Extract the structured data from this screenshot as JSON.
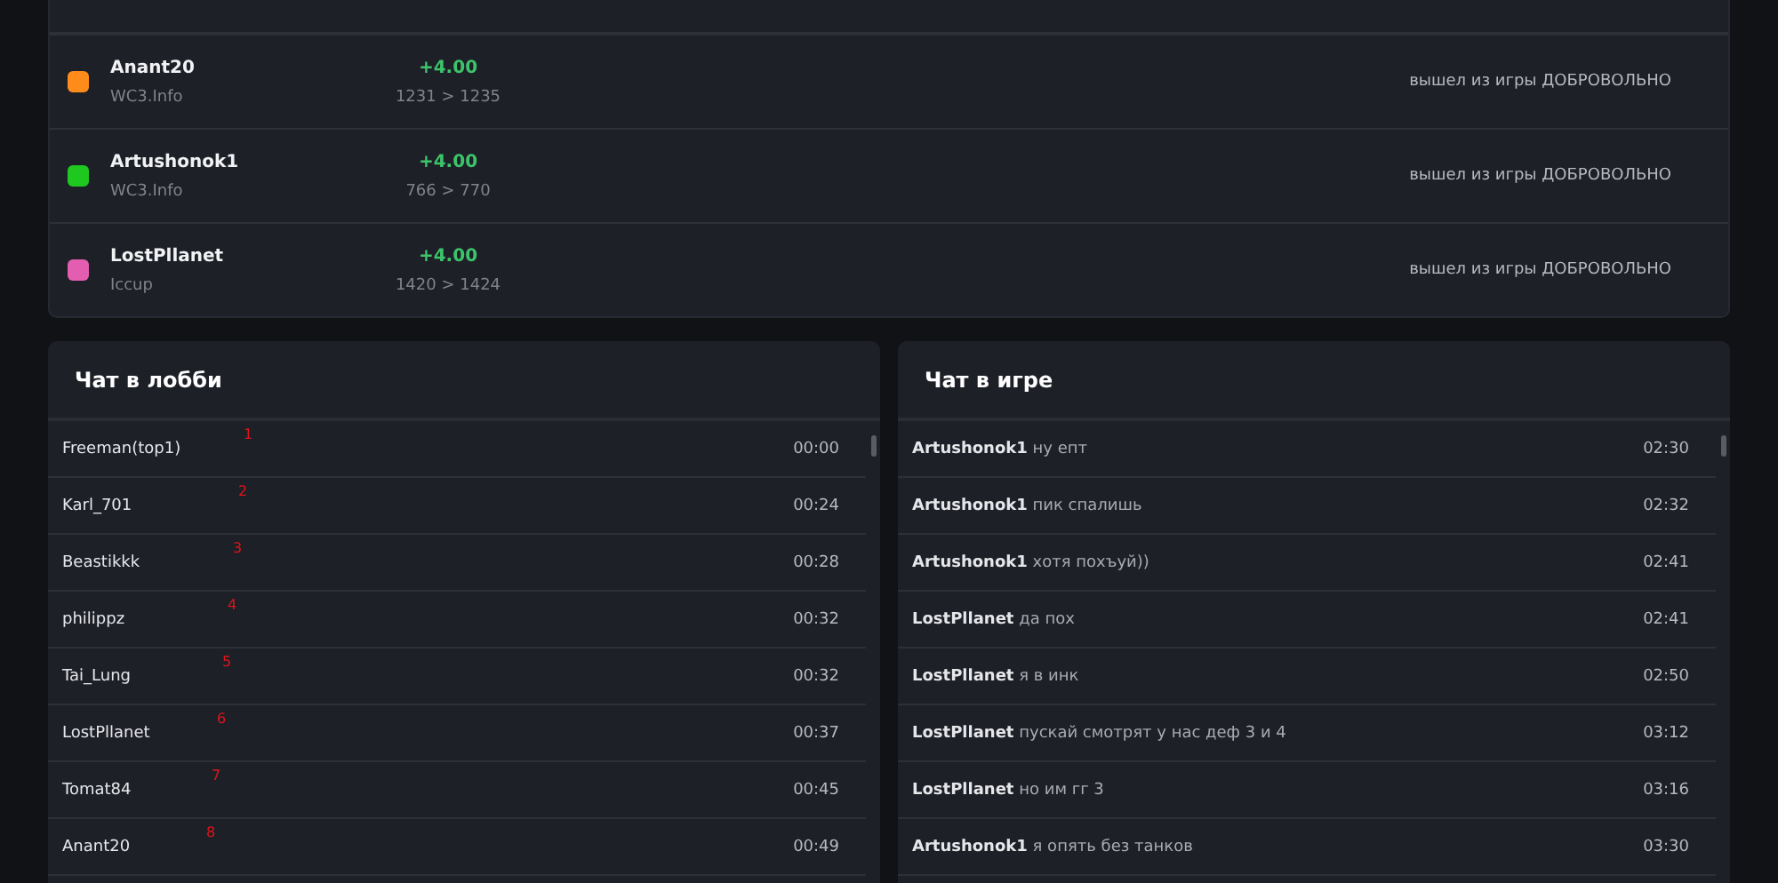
{
  "players": [
    {
      "name": "Anant20",
      "color": "#ff8c1a",
      "source": "WC3.Info",
      "delta": "+4.00",
      "rating": "1231 > 1235",
      "status": "вышел из игры ДОБРОВОЛЬНО"
    },
    {
      "name": "Artushonok1",
      "color": "#1ec81e",
      "source": "WC3.Info",
      "delta": "+4.00",
      "rating": "766 > 770",
      "status": "вышел из игры ДОБРОВОЛЬНО"
    },
    {
      "name": "LostPllanet",
      "color": "#e35db0",
      "source": "Iccup",
      "delta": "+4.00",
      "rating": "1420 > 1424",
      "status": "вышел из игры ДОБРОВОЛЬНО"
    }
  ],
  "lobby_chat": {
    "title": "Чат в лобби",
    "messages": [
      {
        "author": "Freeman(top1)",
        "mark": "1",
        "time": "00:00"
      },
      {
        "author": "Karl_701",
        "mark": "2",
        "time": "00:24"
      },
      {
        "author": "Beastikkk",
        "mark": "3",
        "time": "00:28"
      },
      {
        "author": "philippz",
        "mark": "4",
        "time": "00:32"
      },
      {
        "author": "Tai_Lung",
        "mark": "5",
        "time": "00:32"
      },
      {
        "author": "LostPllanet",
        "mark": "6",
        "time": "00:37"
      },
      {
        "author": "Tomat84",
        "mark": "7",
        "time": "00:45"
      },
      {
        "author": "Anant20",
        "mark": "8",
        "time": "00:49"
      }
    ]
  },
  "game_chat": {
    "title": "Чат в игре",
    "messages": [
      {
        "author": "Artushonok1",
        "text": "ну епт",
        "time": "02:30"
      },
      {
        "author": "Artushonok1",
        "text": "пик спалишь",
        "time": "02:32"
      },
      {
        "author": "Artushonok1",
        "text": "хотя похъуй))",
        "time": "02:41"
      },
      {
        "author": "LostPllanet",
        "text": "да пох",
        "time": "02:41"
      },
      {
        "author": "LostPllanet",
        "text": "я в инк",
        "time": "02:50"
      },
      {
        "author": "LostPllanet",
        "text": "пускай смотрят у нас деф 3 и 4",
        "time": "03:12"
      },
      {
        "author": "LostPllanet",
        "text": "но им гг 3",
        "time": "03:16"
      },
      {
        "author": "Artushonok1",
        "text": "я опять без танков",
        "time": "03:30"
      }
    ]
  }
}
